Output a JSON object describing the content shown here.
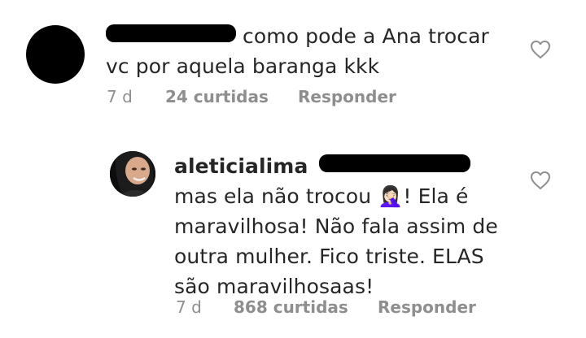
{
  "comments": [
    {
      "username": "",
      "text_line1": "como pode a Ana trocar",
      "text_line2": "vc por aquela baranga kkk",
      "time": "7 d",
      "likes": "24 curtidas",
      "reply": "Responder",
      "avatar_icon": "avatar-redacted",
      "like_icon": "heart-outline-icon"
    },
    {
      "username": "aleticialima",
      "text_line1": "mas ela não trocou 🤦🏻‍♀️! Ela é",
      "text_line2": "maravilhosa! Não fala assim de",
      "text_line3": "outra mulher. Fico triste. ELAS",
      "text_line4": "são maravilhosaas!",
      "time": "7 d",
      "likes": "868 curtidas",
      "reply": "Responder",
      "avatar_icon": "profile-photo",
      "like_icon": "heart-outline-icon"
    }
  ],
  "colors": {
    "text": "#262626",
    "secondary": "#8e8e8e",
    "background": "#ffffff"
  }
}
